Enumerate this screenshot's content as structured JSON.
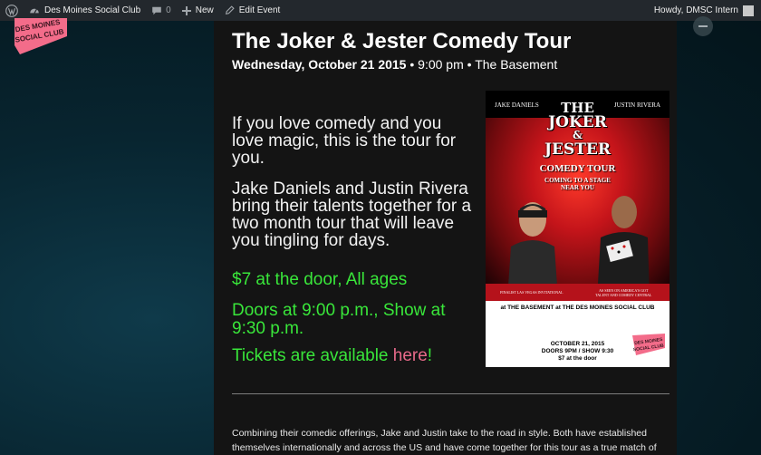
{
  "admin_bar": {
    "site_name": "Des Moines Social Club",
    "comments_count": "0",
    "new_label": "New",
    "edit_label": "Edit Event",
    "user_greeting": "Howdy, DMSC Intern"
  },
  "logo": {
    "line1": "DES MOINES",
    "line2": "SOCIAL CLUB"
  },
  "event": {
    "title": "The Joker & Jester Comedy Tour",
    "date": "Wednesday, October 21 2015",
    "time": "9:00 pm",
    "venue": "The Basement",
    "sep": "•"
  },
  "description": {
    "para1": "If you love comedy and you love magic, this is the tour for you.",
    "para2": "Jake Daniels and Justin Rivera bring their talents together for a two month tour that will leave you tingling for days.",
    "price": "$7 at the door, All ages",
    "doors": "Doors at 9:00 p.m., Show at 9:30 p.m.",
    "tickets_prefix": "Tickets are available ",
    "tickets_link": "here",
    "tickets_suffix": "!",
    "body": "Combining their comedic offerings, Jake and Justin take to the road in style. Both have established themselves internationally and across the US and have come together for this tour as a true match of equals."
  },
  "poster": {
    "name_left": "JAKE DANIELS",
    "name_right": "JUSTIN RIVERA",
    "the": "THE",
    "joker": "JOKER",
    "amp": "&",
    "jester": "JESTER",
    "comedy_tour": "COMEDY TOUR",
    "coming1": "COMING TO A STAGE",
    "coming2": "NEAR YOU",
    "band_left": "FINALIST LAS VEGAS INVITATIONAL",
    "band_right": "AS SEEN ON AMERICA'S GOT TALENT AND COMEDY CENTRAL",
    "venue_line": "at THE BASEMENT at THE DES MOINES SOCIAL CLUB",
    "date_line1": "OCTOBER 21, 2015",
    "date_line2": "DOORS 9PM / SHOW 9:30",
    "date_line3": "$7 at the door",
    "logo_line1": "DES MOINES",
    "logo_line2": "SOCIAL CLUB"
  },
  "colors": {
    "accent_green": "#39e63a",
    "link_pink": "#e86a8a",
    "brand_pink": "#f36c8a"
  }
}
